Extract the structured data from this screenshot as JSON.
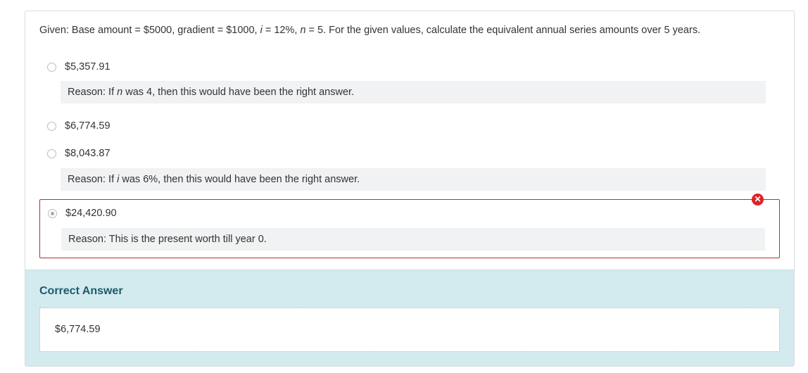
{
  "question": {
    "prefix": "Given: Base amount = $5000, gradient = $1000, ",
    "i_var": "i",
    "mid": " = 12%, ",
    "n_var": "n",
    "suffix": " = 5. For the given values, calculate the equivalent annual series amounts over 5 years."
  },
  "options": [
    {
      "label": "$5,357.91",
      "selected": false,
      "reason": {
        "prefix": "Reason: If ",
        "var": "n",
        "suffix": " was 4, then this would have been the right answer."
      }
    },
    {
      "label": "$6,774.59",
      "selected": false
    },
    {
      "label": "$8,043.87",
      "selected": false,
      "reason": {
        "prefix": "Reason: If ",
        "var": "i",
        "suffix": " was 6%, then this would have been the right answer."
      }
    },
    {
      "label": "$24,420.90",
      "selected": true,
      "status": "incorrect",
      "reason": {
        "text": "Reason: This is the present worth till year 0."
      }
    }
  ],
  "incorrect_icon": "x-circle-icon",
  "correct_answer": {
    "title": "Correct Answer",
    "value": "$6,774.59"
  },
  "colors": {
    "incorrect_border": "#b42f31",
    "incorrect_badge": "#d9262c",
    "correct_section_bg": "#d3eaef",
    "correct_title": "#1c5b6c",
    "reason_bg": "#f0f2f3"
  }
}
